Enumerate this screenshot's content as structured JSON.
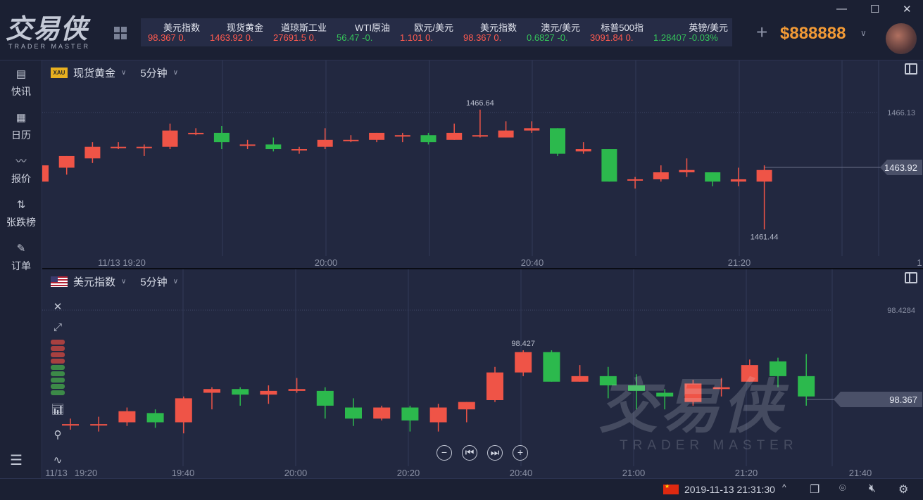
{
  "app": {
    "logo_main": "交易侠",
    "logo_sub": "TRADER MASTER",
    "balance": "$888888",
    "window_controls": {
      "minimize": "—",
      "maximize": "☐",
      "close": "✕"
    }
  },
  "ticker": [
    {
      "name": "美元指数",
      "value": "98.367",
      "change": "0.",
      "dir": "red"
    },
    {
      "name": "现货黄金",
      "value": "1463.92",
      "change": "0.",
      "dir": "red"
    },
    {
      "name": "道琼斯工业",
      "value": "27691.5",
      "change": "0.",
      "dir": "red"
    },
    {
      "name": "WTI原油",
      "value": "56.47",
      "change": "-0.",
      "dir": "green"
    },
    {
      "name": "欧元/美元",
      "value": "1.101",
      "change": "0.",
      "dir": "red"
    },
    {
      "name": "美元指数",
      "value": "98.367",
      "change": "0.",
      "dir": "red"
    },
    {
      "name": "澳元/美元",
      "value": "0.6827",
      "change": "-0.",
      "dir": "green"
    },
    {
      "name": "标普500指",
      "value": "3091.84",
      "change": "0.",
      "dir": "red"
    },
    {
      "name": "英镑/美元",
      "value": "1.28407",
      "change": "-0.03%",
      "dir": "green"
    }
  ],
  "sidebar": {
    "items": [
      {
        "label": "快讯",
        "icon": "news-icon"
      },
      {
        "label": "日历",
        "icon": "calendar-icon"
      },
      {
        "label": "报价",
        "icon": "quote-icon"
      },
      {
        "label": "张跌榜",
        "icon": "updown-icon"
      },
      {
        "label": "订单",
        "icon": "order-icon"
      }
    ]
  },
  "panel1": {
    "badge": "XAU",
    "symbol": "现货黄金",
    "timeframe": "5分钟",
    "high_label": "1466.64",
    "low_label": "1461.44",
    "ref_level": "1466.13",
    "current_price": "1463.92",
    "time_labels": [
      "11/13 19:20",
      "20:00",
      "20:40",
      "21:20",
      "1"
    ]
  },
  "panel2": {
    "symbol": "美元指数",
    "timeframe": "5分钟",
    "high_label": "98.427",
    "ref_level": "98.4284",
    "current_price": "98.367",
    "time_labels": [
      "11/13",
      "19:20",
      "19:40",
      "20:00",
      "20:20",
      "20:40",
      "21:00",
      "21:20",
      "21:40"
    ],
    "nav_buttons": [
      "−",
      "⏮",
      "⏭",
      "+"
    ]
  },
  "watermark": {
    "main": "交易侠",
    "sub": "TRADER MASTER"
  },
  "status": {
    "datetime": "2019-11-13 21:31:30",
    "chevron": "^"
  },
  "colors": {
    "up": "#ef5447",
    "down": "#2cb94d",
    "accent": "#f29a36"
  },
  "chart_data": [
    {
      "type": "candlestick",
      "title": "现货黄金",
      "candles": [
        {
          "o": 1463.5,
          "h": 1464.2,
          "l": 1463.2,
          "c": 1464.2
        },
        {
          "o": 1464.1,
          "h": 1464.6,
          "l": 1463.8,
          "c": 1464.6
        },
        {
          "o": 1464.5,
          "h": 1465.2,
          "l": 1464.3,
          "c": 1465.0
        },
        {
          "o": 1465.0,
          "h": 1465.2,
          "l": 1464.9,
          "c": 1465.0
        },
        {
          "o": 1465.0,
          "h": 1465.1,
          "l": 1464.6,
          "c": 1465.0
        },
        {
          "o": 1465.0,
          "h": 1466.0,
          "l": 1464.9,
          "c": 1465.7
        },
        {
          "o": 1465.6,
          "h": 1465.8,
          "l": 1465.5,
          "c": 1465.6
        },
        {
          "o": 1465.6,
          "h": 1465.9,
          "l": 1464.9,
          "c": 1465.2
        },
        {
          "o": 1465.1,
          "h": 1465.3,
          "l": 1464.9,
          "c": 1465.1
        },
        {
          "o": 1465.1,
          "h": 1465.4,
          "l": 1464.8,
          "c": 1464.9
        },
        {
          "o": 1464.9,
          "h": 1465.0,
          "l": 1464.7,
          "c": 1464.9
        },
        {
          "o": 1465.0,
          "h": 1465.8,
          "l": 1464.9,
          "c": 1465.3
        },
        {
          "o": 1465.3,
          "h": 1465.5,
          "l": 1465.2,
          "c": 1465.3
        },
        {
          "o": 1465.3,
          "h": 1465.6,
          "l": 1465.2,
          "c": 1465.6
        },
        {
          "o": 1465.5,
          "h": 1465.6,
          "l": 1465.2,
          "c": 1465.5
        },
        {
          "o": 1465.5,
          "h": 1465.6,
          "l": 1465.1,
          "c": 1465.2
        },
        {
          "o": 1465.3,
          "h": 1466.0,
          "l": 1465.3,
          "c": 1465.6
        },
        {
          "o": 1465.5,
          "h": 1466.6,
          "l": 1465.4,
          "c": 1465.5
        },
        {
          "o": 1465.4,
          "h": 1466.1,
          "l": 1465.4,
          "c": 1465.7
        },
        {
          "o": 1465.7,
          "h": 1466.1,
          "l": 1465.6,
          "c": 1465.8
        },
        {
          "o": 1465.8,
          "h": 1465.8,
          "l": 1464.6,
          "c": 1464.7
        },
        {
          "o": 1464.8,
          "h": 1465.2,
          "l": 1464.7,
          "c": 1464.9
        },
        {
          "o": 1464.9,
          "h": 1464.9,
          "l": 1463.5,
          "c": 1463.5
        },
        {
          "o": 1463.6,
          "h": 1463.7,
          "l": 1463.2,
          "c": 1463.6
        },
        {
          "o": 1463.6,
          "h": 1464.2,
          "l": 1463.5,
          "c": 1463.9
        },
        {
          "o": 1463.9,
          "h": 1464.5,
          "l": 1463.7,
          "c": 1464.0
        },
        {
          "o": 1463.9,
          "h": 1463.9,
          "l": 1463.3,
          "c": 1463.5
        },
        {
          "o": 1463.5,
          "h": 1464.1,
          "l": 1463.3,
          "c": 1463.6
        },
        {
          "o": 1463.5,
          "h": 1464.2,
          "l": 1461.44,
          "c": 1464.0
        }
      ],
      "ylim": [
        1460.6,
        1466.9
      ]
    },
    {
      "type": "candlestick",
      "title": "美元指数",
      "candles": [
        {
          "o": 98.366,
          "h": 98.369,
          "l": 98.363,
          "c": 98.366
        },
        {
          "o": 98.366,
          "h": 98.37,
          "l": 98.362,
          "c": 98.366
        },
        {
          "o": 98.367,
          "h": 98.375,
          "l": 98.365,
          "c": 98.373
        },
        {
          "o": 98.372,
          "h": 98.374,
          "l": 98.364,
          "c": 98.367
        },
        {
          "o": 98.367,
          "h": 98.381,
          "l": 98.361,
          "c": 98.38
        },
        {
          "o": 98.383,
          "h": 98.386,
          "l": 98.374,
          "c": 98.385
        },
        {
          "o": 98.385,
          "h": 98.386,
          "l": 98.376,
          "c": 98.382
        },
        {
          "o": 98.382,
          "h": 98.387,
          "l": 98.377,
          "c": 98.384
        },
        {
          "o": 98.384,
          "h": 98.391,
          "l": 98.383,
          "c": 98.385
        },
        {
          "o": 98.384,
          "h": 98.386,
          "l": 98.369,
          "c": 98.376
        },
        {
          "o": 98.375,
          "h": 98.38,
          "l": 98.365,
          "c": 98.369
        },
        {
          "o": 98.369,
          "h": 98.376,
          "l": 98.368,
          "c": 98.375
        },
        {
          "o": 98.375,
          "h": 98.376,
          "l": 98.362,
          "c": 98.368
        },
        {
          "o": 98.367,
          "h": 98.377,
          "l": 98.362,
          "c": 98.375
        },
        {
          "o": 98.374,
          "h": 98.378,
          "l": 98.367,
          "c": 98.378
        },
        {
          "o": 98.379,
          "h": 98.397,
          "l": 98.378,
          "c": 98.394
        },
        {
          "o": 98.394,
          "h": 98.406,
          "l": 98.392,
          "c": 98.405
        },
        {
          "o": 98.405,
          "h": 98.406,
          "l": 98.389,
          "c": 98.389
        },
        {
          "o": 98.389,
          "h": 98.398,
          "l": 98.389,
          "c": 98.392
        },
        {
          "o": 98.392,
          "h": 98.397,
          "l": 98.38,
          "c": 98.387
        },
        {
          "o": 98.387,
          "h": 98.393,
          "l": 98.374,
          "c": 98.384
        },
        {
          "o": 98.383,
          "h": 98.385,
          "l": 98.374,
          "c": 98.381
        },
        {
          "o": 98.378,
          "h": 98.39,
          "l": 98.376,
          "c": 98.388
        },
        {
          "o": 98.385,
          "h": 98.391,
          "l": 98.381,
          "c": 98.386
        },
        {
          "o": 98.389,
          "h": 98.401,
          "l": 98.389,
          "c": 98.398
        },
        {
          "o": 98.4,
          "h": 98.402,
          "l": 98.386,
          "c": 98.392
        },
        {
          "o": 98.392,
          "h": 98.404,
          "l": 98.376,
          "c": 98.381
        }
      ],
      "ylim": [
        98.347,
        98.427
      ]
    }
  ]
}
